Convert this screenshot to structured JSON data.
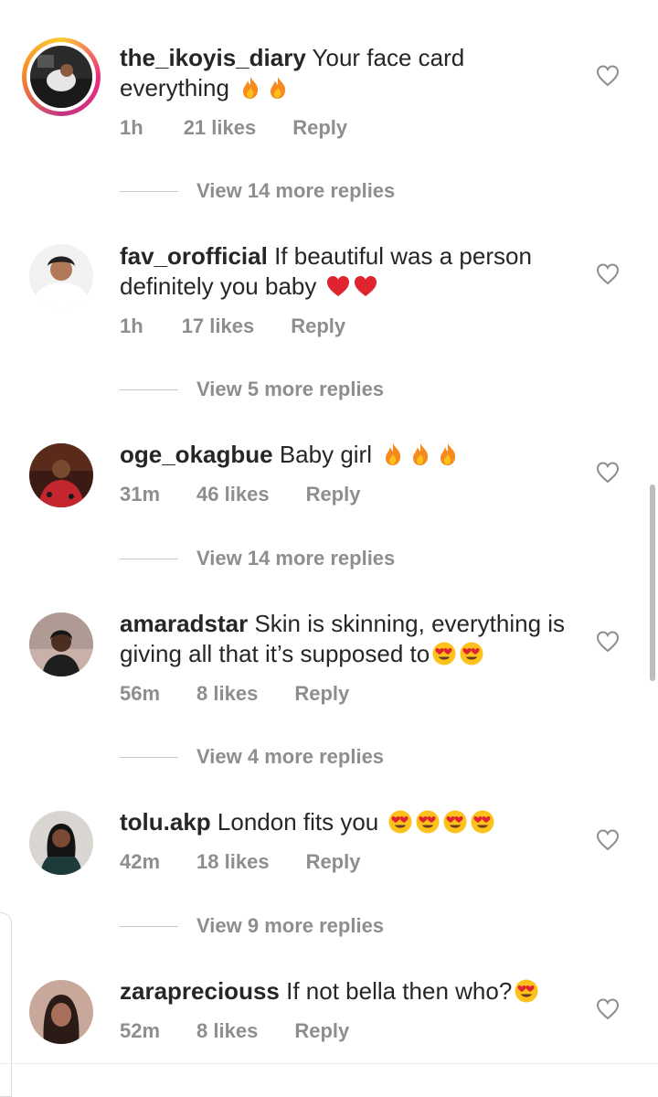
{
  "comments": [
    {
      "username": "the_ikoyis_diary",
      "text": "Your face card everything",
      "emoji": [
        "fire",
        "fire"
      ],
      "time": "1h",
      "likes": "21 likes",
      "reply": "Reply",
      "view_more": "View 14 more replies",
      "has_story": true
    },
    {
      "username": "fav_orofficial",
      "text": "If beautiful was a person definitely you baby",
      "emoji": [
        "heart",
        "heart"
      ],
      "time": "1h",
      "likes": "17 likes",
      "reply": "Reply",
      "view_more": "View 5 more replies"
    },
    {
      "username": "oge_okagbue",
      "text": "Baby girl",
      "emoji": [
        "fire",
        "fire",
        "fire"
      ],
      "time": "31m",
      "likes": "46 likes",
      "reply": "Reply",
      "view_more": "View 14 more replies"
    },
    {
      "username": "amaradstar",
      "text": "Skin is skinning, everything is giving all that it’s supposed to",
      "emoji": [
        "heart-eyes",
        "heart-eyes"
      ],
      "time": "56m",
      "likes": "8 likes",
      "reply": "Reply",
      "view_more": "View 4 more replies"
    },
    {
      "username": "tolu.akp",
      "text": "London fits you",
      "emoji": [
        "heart-eyes",
        "heart-eyes",
        "heart-eyes",
        "heart-eyes"
      ],
      "time": "42m",
      "likes": "18 likes",
      "reply": "Reply",
      "view_more": "View 9 more replies"
    },
    {
      "username": "zarapreciouss",
      "text": "If not bella then who?",
      "emoji": [
        "heart-eyes"
      ],
      "time": "52m",
      "likes": "8 likes",
      "reply": "Reply"
    }
  ],
  "colors": {
    "text": "#262626",
    "secondary": "#8e8e8e",
    "heart_red": "#e0242f",
    "fire": "#f58a1f",
    "emoji_face": "#fcc21b"
  }
}
